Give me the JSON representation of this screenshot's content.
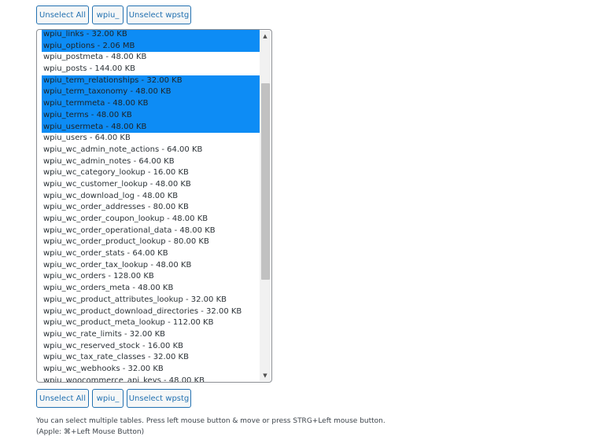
{
  "buttons_top": {
    "unselect_all": "Unselect All",
    "prefix": "wpiu_",
    "unselect_wpstg": "Unselect wpstg"
  },
  "buttons_bottom": {
    "unselect_all": "Unselect All",
    "prefix": "wpiu_",
    "unselect_wpstg": "Unselect wpstg"
  },
  "tables": [
    {
      "label": "wpiu_links - 32.00 KB",
      "selected": true
    },
    {
      "label": "wpiu_options - 2.06 MB",
      "selected": true
    },
    {
      "label": "wpiu_postmeta - 48.00 KB",
      "selected": false
    },
    {
      "label": "wpiu_posts - 144.00 KB",
      "selected": false
    },
    {
      "label": "wpiu_term_relationships - 32.00 KB",
      "selected": true
    },
    {
      "label": "wpiu_term_taxonomy - 48.00 KB",
      "selected": true
    },
    {
      "label": "wpiu_termmeta - 48.00 KB",
      "selected": true
    },
    {
      "label": "wpiu_terms - 48.00 KB",
      "selected": true
    },
    {
      "label": "wpiu_usermeta - 48.00 KB",
      "selected": true
    },
    {
      "label": "wpiu_users - 64.00 KB",
      "selected": false
    },
    {
      "label": "wpiu_wc_admin_note_actions - 64.00 KB",
      "selected": false
    },
    {
      "label": "wpiu_wc_admin_notes - 64.00 KB",
      "selected": false
    },
    {
      "label": "wpiu_wc_category_lookup - 16.00 KB",
      "selected": false
    },
    {
      "label": "wpiu_wc_customer_lookup - 48.00 KB",
      "selected": false
    },
    {
      "label": "wpiu_wc_download_log - 48.00 KB",
      "selected": false
    },
    {
      "label": "wpiu_wc_order_addresses - 80.00 KB",
      "selected": false
    },
    {
      "label": "wpiu_wc_order_coupon_lookup - 48.00 KB",
      "selected": false
    },
    {
      "label": "wpiu_wc_order_operational_data - 48.00 KB",
      "selected": false
    },
    {
      "label": "wpiu_wc_order_product_lookup - 80.00 KB",
      "selected": false
    },
    {
      "label": "wpiu_wc_order_stats - 64.00 KB",
      "selected": false
    },
    {
      "label": "wpiu_wc_order_tax_lookup - 48.00 KB",
      "selected": false
    },
    {
      "label": "wpiu_wc_orders - 128.00 KB",
      "selected": false
    },
    {
      "label": "wpiu_wc_orders_meta - 48.00 KB",
      "selected": false
    },
    {
      "label": "wpiu_wc_product_attributes_lookup - 32.00 KB",
      "selected": false
    },
    {
      "label": "wpiu_wc_product_download_directories - 32.00 KB",
      "selected": false
    },
    {
      "label": "wpiu_wc_product_meta_lookup - 112.00 KB",
      "selected": false
    },
    {
      "label": "wpiu_wc_rate_limits - 32.00 KB",
      "selected": false
    },
    {
      "label": "wpiu_wc_reserved_stock - 16.00 KB",
      "selected": false
    },
    {
      "label": "wpiu_wc_tax_rate_classes - 32.00 KB",
      "selected": false
    },
    {
      "label": "wpiu_wc_webhooks - 32.00 KB",
      "selected": false
    },
    {
      "label": "wpiu_woocommerce_api_keys - 48.00 KB",
      "selected": false
    }
  ],
  "scrollbar": {
    "up_icon": "▲",
    "down_icon": "▼"
  },
  "help": {
    "line1": "You can select multiple tables. Press left mouse button & move or press STRG+Left mouse button.",
    "line2": "(Apple: ⌘+Left Mouse Button)"
  }
}
